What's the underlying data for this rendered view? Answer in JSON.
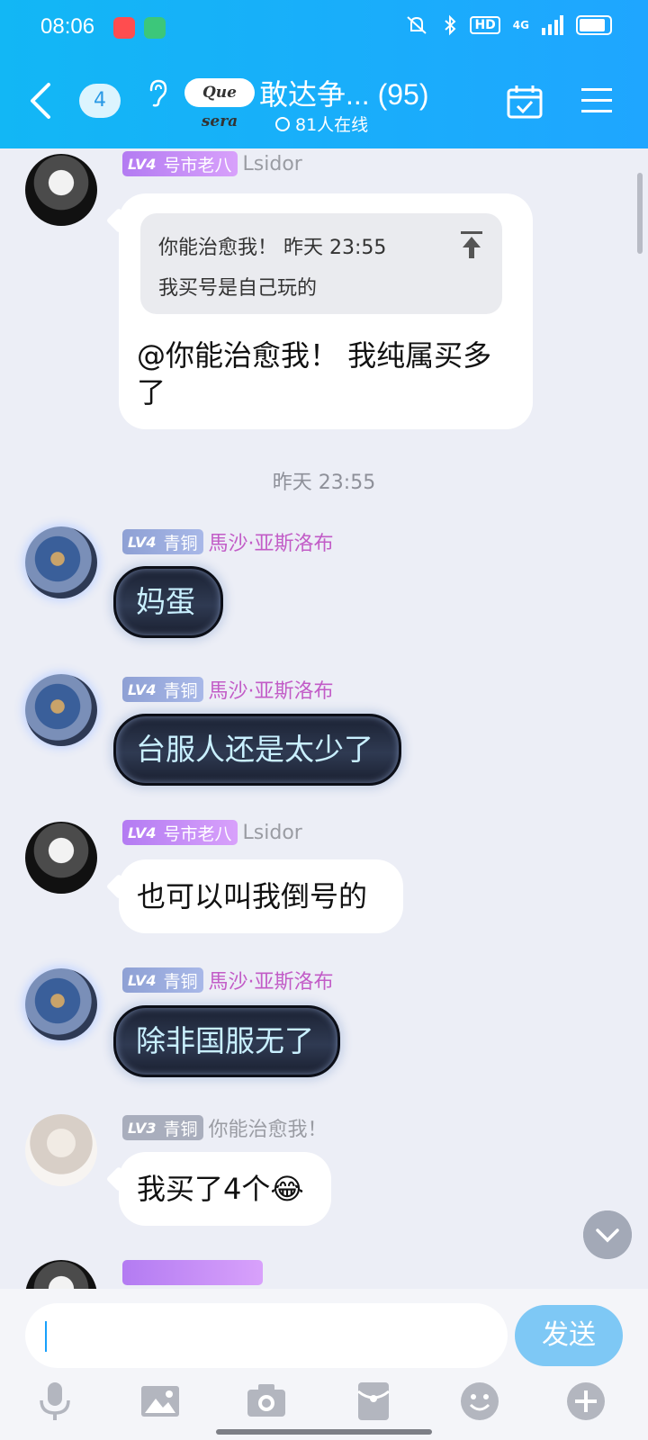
{
  "status_bar": {
    "time": "08:06",
    "network": "4G",
    "hd": "HD"
  },
  "header": {
    "unread_count": "4",
    "group_logo": "Que sera",
    "title": "敢达争... (95)",
    "online": "81人在线"
  },
  "messages": [
    {
      "level": "LV4",
      "badge": "号市老八",
      "nickname": "Lsidor",
      "quote_header": "你能治愈我！ 昨天 23:55",
      "quote_text": "我买号是自己玩的",
      "text_line1": "@你能治愈我！ 我纯属买多",
      "text_line2": "了"
    },
    {
      "timestamp": "昨天 23:55"
    },
    {
      "level": "LV4",
      "badge": "青铜",
      "nickname": "馬沙·亚斯洛布",
      "text": "妈蛋"
    },
    {
      "level": "LV4",
      "badge": "青铜",
      "nickname": "馬沙·亚斯洛布",
      "text": "台服人还是太少了"
    },
    {
      "level": "LV4",
      "badge": "号市老八",
      "nickname": "Lsidor",
      "text": "也可以叫我倒号的"
    },
    {
      "level": "LV4",
      "badge": "青铜",
      "nickname": "馬沙·亚斯洛布",
      "text": "除非国服无了"
    },
    {
      "level": "LV3",
      "badge": "青铜",
      "nickname": "你能治愈我！",
      "text": "我买了4个",
      "emoji": "😂"
    }
  ],
  "input": {
    "send_label": "发送"
  },
  "colors": {
    "header": "#12b7f5",
    "send": "#7ec8f5",
    "background": "#eceef6"
  }
}
